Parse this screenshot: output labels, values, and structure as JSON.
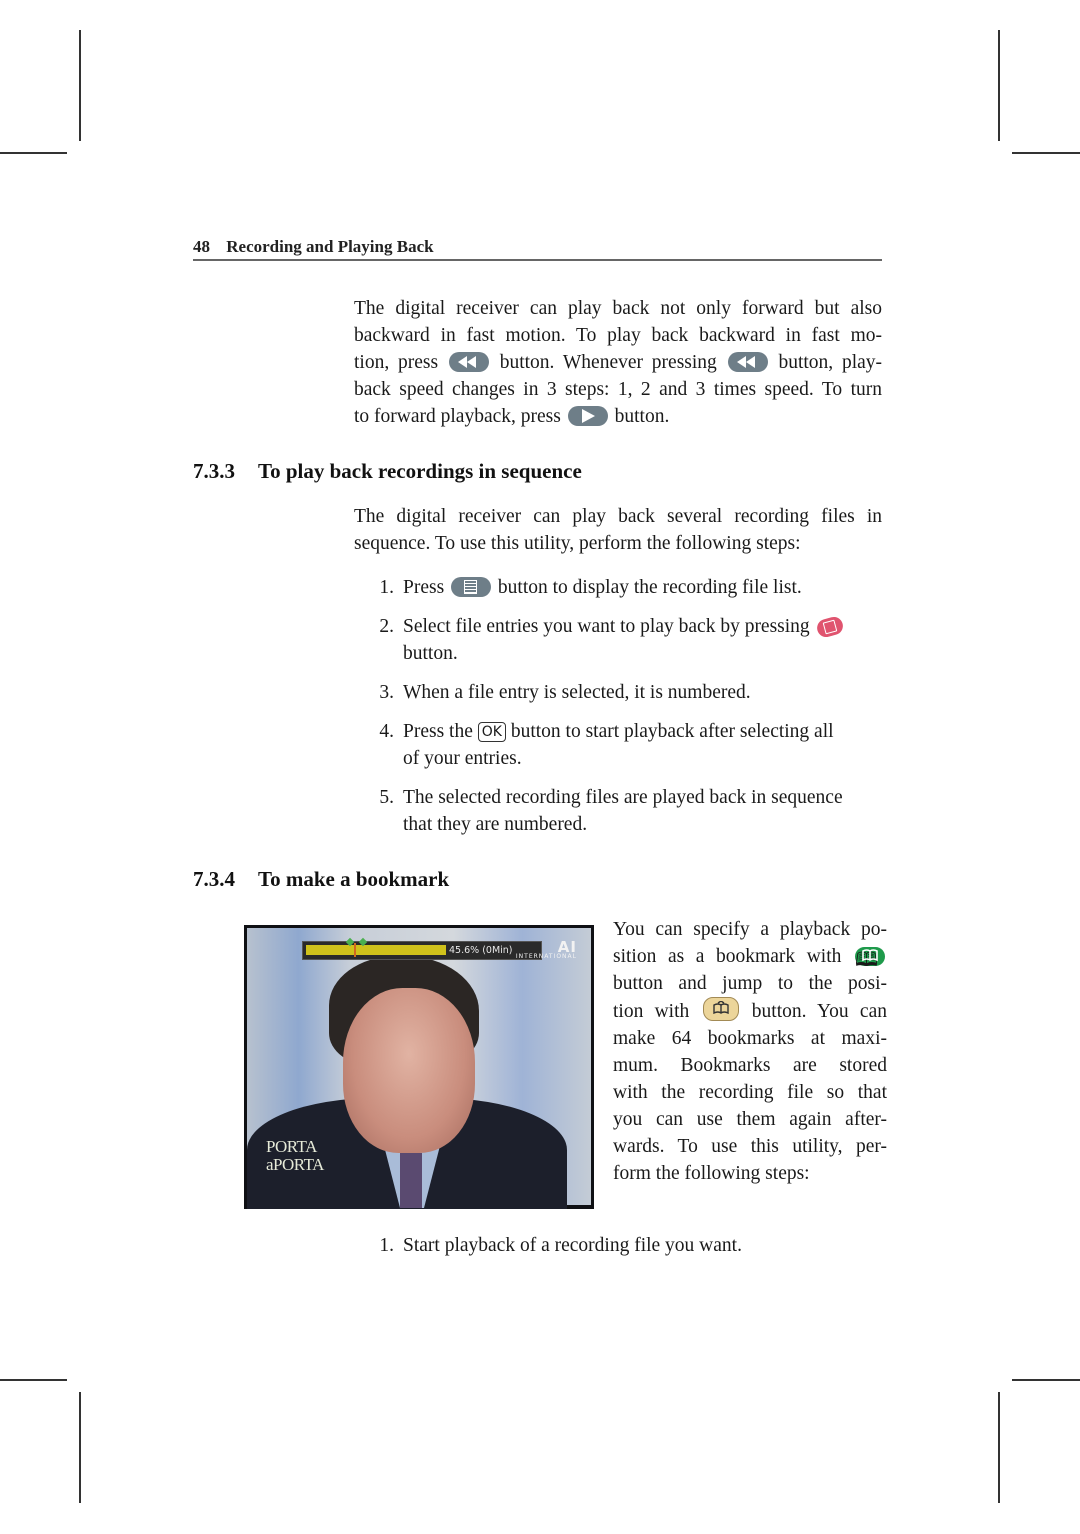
{
  "header": {
    "page_number": "48",
    "chapter_title": "Recording and Playing Back"
  },
  "intro_paragraph": {
    "lines": [
      "The digital receiver can play back not only forward but also",
      "backward in fast motion. To play back backward in fast mo-",
      [
        "tion, press",
        "rewind-button",
        "button. Whenever pressing",
        "rewind-button",
        "button, play-"
      ],
      "back speed changes in 3 steps: 1, 2 and 3 times speed. To turn",
      [
        "to forward playback, press",
        "play-button",
        "button."
      ]
    ],
    "line1": "The digital receiver can play back not only forward but also",
    "line2": "backward in fast motion. To play back backward in fast mo-",
    "line3a": "tion, press",
    "line3b": "button. Whenever pressing",
    "line3c": "button, play-",
    "line4": "back speed changes in 3 steps: 1, 2 and 3 times speed. To turn",
    "line5a": "to forward playback, press",
    "line5b": "button."
  },
  "section_733": {
    "number": "7.3.3",
    "title": "To play back recordings in sequence",
    "intro_line1": "The digital receiver can play back several recording files in",
    "intro_line2": "sequence. To use this utility, perform the following steps:",
    "steps": [
      {
        "n": "1.",
        "a": "Press",
        "icon": "file-list-button",
        "b": "button to display the recording file list."
      },
      {
        "n": "2.",
        "a": "Select file entries you want to play back by pressing",
        "icon": "red-select-button",
        "b": "button."
      },
      {
        "n": "3.",
        "a": "When a file entry is selected, it is numbered."
      },
      {
        "n": "4.",
        "a": "Press the",
        "key": "OK",
        "b": "button to start playback after selecting all",
        "c": "of your entries."
      },
      {
        "n": "5.",
        "a": "The selected recording files are played back in sequence",
        "b": "that they are numbered."
      }
    ]
  },
  "section_734": {
    "number": "7.3.4",
    "title": "To make a bookmark",
    "lines": {
      "l1": "You can specify a playback po-",
      "l2a": "sition as a bookmark with",
      "l3": "button and jump to the posi-",
      "l4a": "tion with",
      "l4b": "button. You can",
      "l5": "make 64 bookmarks at maxi-",
      "l6": "mum.  Bookmarks are stored",
      "l7": "with the recording file so that",
      "l8": "you can use them again after-",
      "l9": "wards. To use this utility, per-",
      "l10": "form the following steps:"
    },
    "steps": [
      {
        "n": "1.",
        "a": "Start playback of a recording file you want."
      }
    ]
  },
  "screenshot": {
    "progress_percent": 45.6,
    "progress_label": "45.6% (0Min)",
    "bookmark_positions_percent": [
      29.0,
      38.5
    ],
    "current_position_percent": 34,
    "channel_logo": "AI",
    "channel_logo_sub": "INTERNATIONAL",
    "show_logo_line1": "PORTA",
    "show_logo_line2": "aPORTA"
  },
  "colors": {
    "button_gray": "#6e7e88",
    "button_red": "#e0546f",
    "button_green": "#1e9a4b",
    "button_tan": "#ecd59a",
    "progress_fill": "#d0c21b"
  }
}
